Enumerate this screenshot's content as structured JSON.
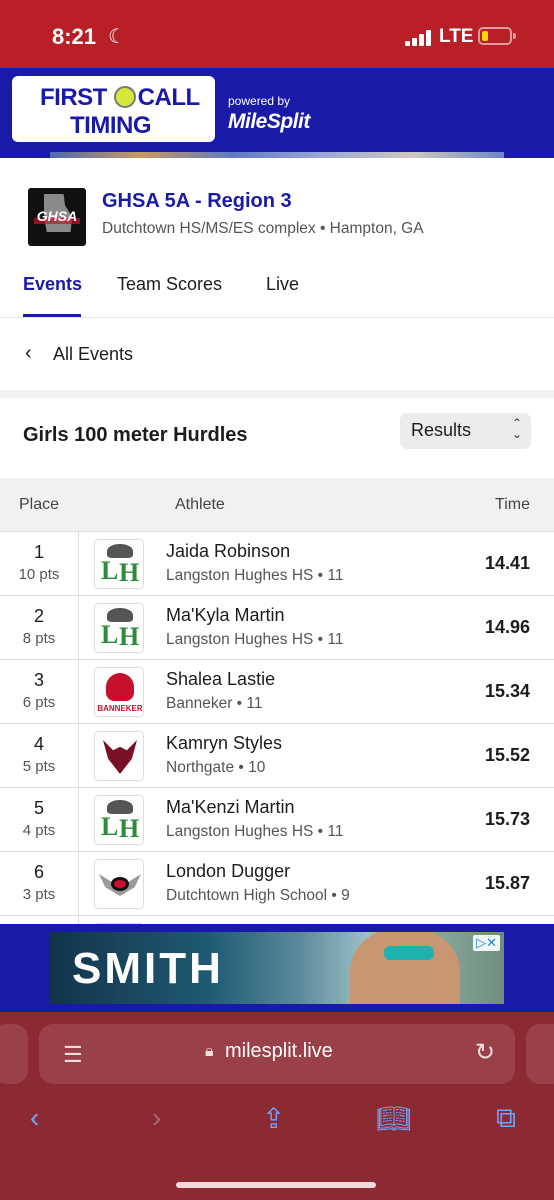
{
  "status_bar": {
    "time": "8:21",
    "moon_icon": "☾",
    "network": "LTE"
  },
  "banner": {
    "logo_line1": "FIRST",
    "logo_line1b": "CALL",
    "logo_line2": "TIMING",
    "powered_by": "powered by",
    "partner": "MileSplit"
  },
  "meet": {
    "logo_text": "GHSA",
    "title": "GHSA 5A - Region 3",
    "location": "Dutchtown HS/MS/ES complex • Hampton, GA"
  },
  "tabs": [
    {
      "label": "Events",
      "active": true
    },
    {
      "label": "Team Scores",
      "active": false
    },
    {
      "label": "Live",
      "active": false
    }
  ],
  "nav": {
    "back_label": "All Events"
  },
  "event": {
    "title": "Girls 100 meter Hurdles",
    "view_select": "Results",
    "columns": {
      "place": "Place",
      "athlete": "Athlete",
      "time": "Time"
    },
    "results": [
      {
        "place": "1",
        "points": "10 pts",
        "athlete": "Jaida Robinson",
        "team": "Langston Hughes HS • 11",
        "time": "14.41",
        "logo": "langston-hughes"
      },
      {
        "place": "2",
        "points": "8 pts",
        "athlete": "Ma'Kyla Martin",
        "team": "Langston Hughes HS • 11",
        "time": "14.96",
        "logo": "langston-hughes"
      },
      {
        "place": "3",
        "points": "6 pts",
        "athlete": "Shalea Lastie",
        "team": "Banneker • 11",
        "time": "15.34",
        "logo": "banneker"
      },
      {
        "place": "4",
        "points": "5 pts",
        "athlete": "Kamryn Styles",
        "team": "Northgate • 10",
        "time": "15.52",
        "logo": "northgate"
      },
      {
        "place": "5",
        "points": "4 pts",
        "athlete": "Ma'Kenzi Martin",
        "team": "Langston Hughes HS • 11",
        "time": "15.73",
        "logo": "langston-hughes"
      },
      {
        "place": "6",
        "points": "3 pts",
        "athlete": "London Dugger",
        "team": "Dutchtown High School • 9",
        "time": "15.87",
        "logo": "dutchtown"
      }
    ],
    "banneker_logo_word": "BANNEKER"
  },
  "ad": {
    "brand": "SMITH",
    "choices_label": "▷✕"
  },
  "browser": {
    "url": "milesplit.live"
  },
  "colors": {
    "status_red": "#b91f26",
    "brand_blue": "#1a1aa8",
    "browser_bar": "#8b2a33",
    "toolbar_blue": "#6aa8ff"
  }
}
